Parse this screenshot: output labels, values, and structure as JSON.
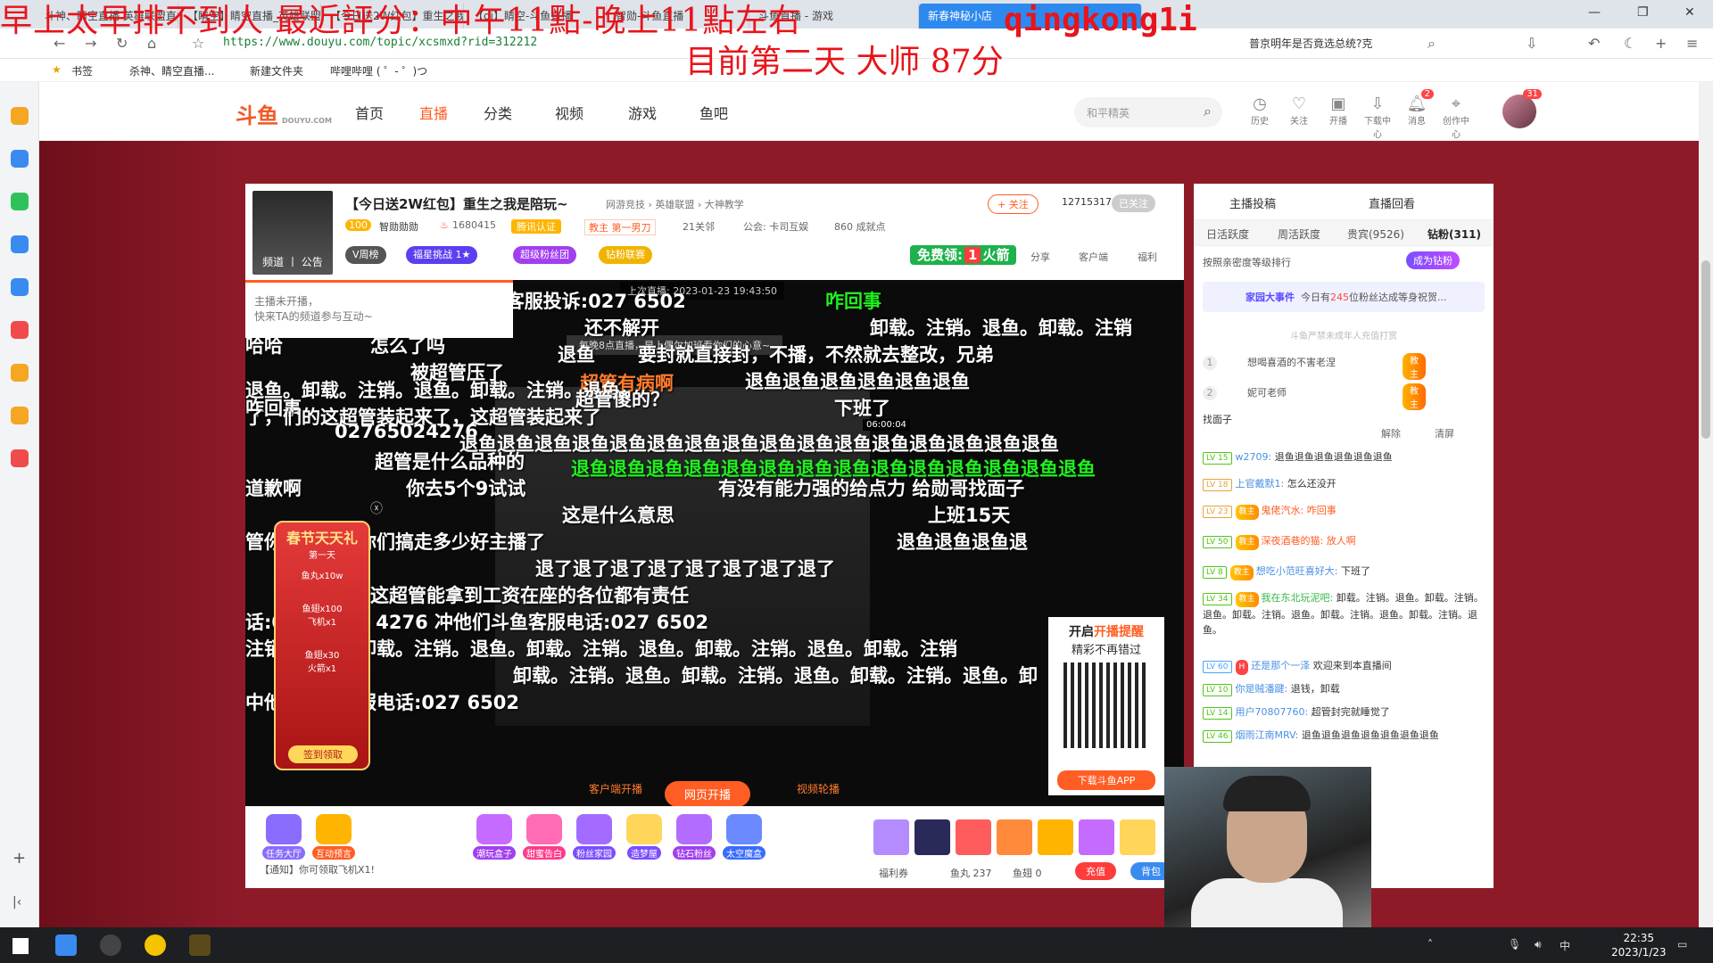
{
  "overlay": {
    "line1": "早上太早排不到人 最近評分：中午11點-晚上11點左右",
    "handle": "qingkong1i",
    "line2": "目前第二天 大师 87分"
  },
  "browser": {
    "tabs": [
      "斗神、睛空直播 英雄联盟直播_...",
      "【睛空】睛空直播_英雄联盟...",
      "【今日送2W红包】重生之我是...",
      "【qi】睛空-斗鱼直播",
      "智勋-斗鱼直播",
      "斗鱼直播 - 游戏",
      "新春神秘小店"
    ],
    "active_tab": "新春神秘小店",
    "url": "https://www.douyu.com/topic/xcsmxd?rid=312212",
    "search_hint": "普京明年是否竟选总统?克",
    "bookmarks": [
      "书签",
      "杀神、睛空直播...",
      "新建文件夹",
      "哔哩哔哩 ( ゜- ゜)つ"
    ]
  },
  "douyu": {
    "logo": "斗鱼",
    "logo_sub": "DOUYU.COM",
    "nav": [
      "首页",
      "直播",
      "分类",
      "视频",
      "游戏",
      "鱼吧"
    ],
    "active_nav": "直播",
    "search_placeholder": "和平精英",
    "header_icons": [
      {
        "label": "历史",
        "icon": "clock-icon"
      },
      {
        "label": "关注",
        "icon": "heart-icon"
      },
      {
        "label": "开播",
        "icon": "camera-icon"
      },
      {
        "label": "下载中心",
        "icon": "download-icon"
      },
      {
        "label": "消息",
        "icon": "bell-icon",
        "badge": "2"
      },
      {
        "label": "创作中心",
        "icon": "location-icon"
      }
    ],
    "avatar_badge": "31"
  },
  "room": {
    "avatar_tag": "频道 丨 公告",
    "title": "【今日送2W红包】重生之我是陪玩~",
    "category": "网游竞技 › 英雄联盟 › 大神教学",
    "follow_btn": "+ 关注",
    "fans": "12715317",
    "followed": "已关注",
    "level": "100",
    "anchor_name": "智勋勋勋",
    "hot": "1680415",
    "cert": "腾讯认证",
    "tag": "教主 第一男刀",
    "fans_group": "21关邻",
    "notice": "公会: 卡司互娱",
    "achievement": "860 成就点",
    "pills": [
      "V周榜",
      "福星挑战 1★",
      "超级粉丝团",
      "钻粉联赛"
    ],
    "free_label": "免费领:",
    "free_count": "1",
    "free_item": "火箭",
    "tools": [
      "分享",
      "客户端",
      "福利"
    ]
  },
  "video": {
    "notice_line1": "主播未开播，",
    "notice_line2": "快来TA的频道参与互动~",
    "last_live": "上次直播: 2023-01-23 19:43:50",
    "center_caption": "每晚8点直播，早上偶尔加班看你们的心意~",
    "danmaku": [
      {
        "t": "的电话:027 6502 4276冲他们斗鱼客服投诉:027 6502",
        "c": "w"
      },
      {
        "t": "咋回事",
        "c": "g"
      },
      {
        "t": "卸载。注销。退鱼。卸载。注销",
        "c": "w"
      },
      {
        "t": "还不解开",
        "c": "w"
      },
      {
        "t": "哈哈",
        "c": "w"
      },
      {
        "t": "怎么了吗",
        "c": "w"
      },
      {
        "t": "退鱼",
        "c": "w"
      },
      {
        "t": "要封就直接封，不播，不然就去整改，兄弟",
        "c": "w"
      },
      {
        "t": "被超管压了",
        "c": "w"
      },
      {
        "t": "退鱼退鱼退鱼退鱼退鱼退鱼",
        "c": "w"
      },
      {
        "t": "超管有病啊",
        "c": "o"
      },
      {
        "t": "退鱼。卸载。注销。退鱼。卸载。注销。退鱼。",
        "c": "w"
      },
      {
        "t": "咋回事",
        "c": "w"
      },
      {
        "t": "了，们的这超管装起来了，这超管装起来了",
        "c": "w"
      },
      {
        "t": "超管傻的？",
        "c": "w"
      },
      {
        "t": "下班了",
        "c": "w"
      },
      {
        "t": "02765024276",
        "c": "w"
      },
      {
        "t": "退鱼退鱼退鱼退鱼退鱼退鱼退鱼退鱼退鱼退鱼退鱼退鱼退鱼退鱼退鱼退鱼",
        "c": "w"
      },
      {
        "t": "超管是什么品种的",
        "c": "w"
      },
      {
        "t": "退鱼退鱼退鱼退鱼退鱼退鱼退鱼退鱼退鱼退鱼退鱼退鱼退鱼退鱼",
        "c": "g"
      },
      {
        "t": "道歉啊",
        "c": "w"
      },
      {
        "t": "你去5个9试试",
        "c": "w"
      },
      {
        "t": "有没有能力强的给点力 给勋哥找面子",
        "c": "w"
      },
      {
        "t": "这是什么意思",
        "c": "w"
      },
      {
        "t": "上班15天",
        "c": "w"
      },
      {
        "t": "管你们自己说你们搞走多少好主播了",
        "c": "w"
      },
      {
        "t": "退鱼退鱼退鱼退",
        "c": "w"
      },
      {
        "t": "退了退了退了退了退了退了退了退了",
        "c": "w"
      },
      {
        "t": "这超管能拿到工资在座的各位都有责任",
        "c": "w"
      },
      {
        "t": "话:027 6502 4276 冲他们斗鱼客服电话:027 6502",
        "c": "w"
      },
      {
        "t": "注销。退鱼。卸载。注销。退鱼。卸载。注销。退鱼。卸载。注销。退鱼。卸载。注销",
        "c": "w"
      },
      {
        "t": "卸载。注销。退鱼。卸载。注销。退鱼。卸载。注销。退鱼。卸",
        "c": "w"
      },
      {
        "t": "中他们斗鱼客服电话:027 6502",
        "c": "w"
      }
    ],
    "gift_title": "春节天天礼",
    "gift_day": "第一天",
    "gift_items": [
      "鱼丸x10w",
      "鱼翅x100",
      "飞机x1",
      "鱼翅x30",
      "火箭x1"
    ],
    "gift_sign": "签到领取",
    "qr_title_a": "开启",
    "qr_title_b": "开播提醒",
    "qr_sub": "精彩不再错过",
    "qr_btn": "下载斗鱼APP",
    "ctrl_left": "客户端开播",
    "ctrl_mid": "网页开播",
    "ctrl_right": "视频轮播",
    "video_timer": "06:00:04"
  },
  "toolbar": {
    "items": [
      "任务大厅",
      "互动预言",
      "潮玩盒子",
      "甜蜜告白",
      "粉丝家园",
      "造梦屋",
      "钻石粉丝",
      "太空魔盒"
    ],
    "notice": "【通知】你可领取飞机X1!",
    "welfare": "福利券",
    "fishball": "鱼丸 237",
    "fishfin": "鱼翅 0",
    "charge": "充值",
    "bag": "背包"
  },
  "chat": {
    "top_left": "主播投稿",
    "top_right": "直播回看",
    "tabs": [
      "日活跃度",
      "周活跃度",
      "贵宾(9526)",
      "钻粉(311)"
    ],
    "active_tab": "钻粉(311)",
    "rank_label": "按照亲密度等级排行",
    "rank_btn": "成为钻粉",
    "event_title": "家园大事件",
    "event_text_a": "今日有",
    "event_count": "245",
    "event_text_b": "位粉丝达成等身祝贺...",
    "minor_notice": "斗鱼严禁未成年人充值打赏",
    "ranks": [
      {
        "n": "1",
        "name": "想喝喜酒的不害老涅",
        "tag": "教主"
      },
      {
        "n": "2",
        "name": "妮可老师",
        "tag": "教主"
      }
    ],
    "clip": "找面子",
    "tools": [
      "解除",
      "清屏"
    ],
    "messages": [
      {
        "lv": "LV 15",
        "user": "w2709:",
        "text": "退鱼退鱼退鱼退鱼退鱼退鱼",
        "cls": "b",
        "medal": ""
      },
      {
        "lv": "LV 18",
        "user": "上官戴默1:",
        "text": "怎么还没开",
        "cls": "b",
        "medal": ""
      },
      {
        "lv": "LV 23",
        "user": "鬼佬汽水:",
        "text": "咋回事",
        "cls": "r",
        "medal": "教主"
      },
      {
        "lv": "LV 50",
        "user": "深夜酒巷的猫:",
        "text": "放人啊",
        "cls": "r",
        "medal": "教主"
      },
      {
        "lv": "LV 8",
        "user": "想吃小范旺喜好大:",
        "text": "下班了",
        "cls": "b",
        "medal": "教主"
      },
      {
        "lv": "LV 34",
        "user": "我在东北玩泥吧:",
        "text": "卸载。注销。退鱼。卸载。注销。退鱼。卸载。注销。退鱼。卸载。注销。退鱼。卸载。注销。退鱼。",
        "cls": "g",
        "medal": "教主"
      },
      {
        "lv": "LV 60",
        "user": "还是那个一泽",
        "text": "欢迎来到本直播间",
        "cls": "b",
        "medal": "H"
      },
      {
        "lv": "LV 10",
        "user": "你是贼潘踺:",
        "text": "退钱，卸载",
        "cls": "b",
        "medal": ""
      },
      {
        "lv": "LV 14",
        "user": "用户70807760:",
        "text": "超管封完就睡觉了",
        "cls": "b",
        "medal": ""
      },
      {
        "lv": "LV 46",
        "user": "烟雨江南MRV:",
        "text": "退鱼退鱼退鱼退鱼退鱼退鱼退鱼",
        "cls": "b",
        "medal": ""
      }
    ]
  },
  "taskbar": {
    "time": "22:35",
    "date": "2023/1/23",
    "ime": "中"
  }
}
